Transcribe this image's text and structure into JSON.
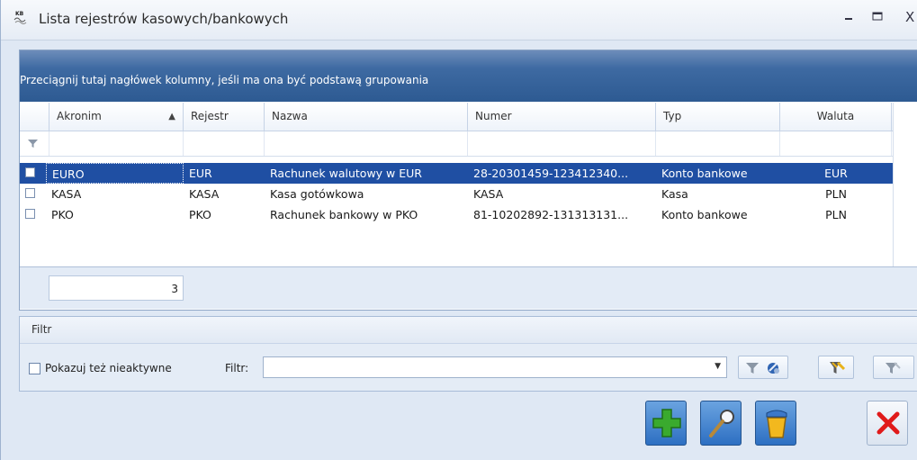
{
  "window": {
    "title": "Lista rejestrów kasowych/bankowych",
    "app_icon": "kb-register-icon",
    "controls": [
      "minimize",
      "maximize",
      "close"
    ],
    "close_glyph": "X"
  },
  "grid": {
    "group_hint": "Przeciągnij tutaj nagłówek kolumny, jeśli ma ona być podstawą grupowania",
    "columns": [
      "Akronim",
      "Rejestr",
      "Nazwa",
      "Numer",
      "Typ",
      "Waluta"
    ],
    "sort_indicator": "▲",
    "filter_row_icon": "funnel-icon",
    "rows": [
      {
        "akronim": "EURO",
        "rejestr": "EUR",
        "nazwa": "Rachunek walutowy w EUR",
        "numer": "28-20301459-123412340...",
        "typ": "Konto bankowe",
        "waluta": "EUR",
        "selected": true
      },
      {
        "akronim": "KASA",
        "rejestr": "KASA",
        "nazwa": "Kasa gotówkowa",
        "numer": "KASA",
        "typ": "Kasa",
        "waluta": "PLN",
        "selected": false
      },
      {
        "akronim": "PKO",
        "rejestr": "PKO",
        "nazwa": "Rachunek bankowy w PKO",
        "numer": "81-10202892-131313131...",
        "typ": "Konto bankowe",
        "waluta": "PLN",
        "selected": false
      }
    ],
    "count": "3"
  },
  "filter_panel": {
    "header": "Filtr",
    "show_inactive_label": "Pokazuj też nieaktywne",
    "show_inactive_checked": false,
    "filter_label": "Filtr:",
    "filter_value": "",
    "tools": [
      "funnel-icon",
      "filter-wizard-icon",
      "filter-edit-icon",
      "filter-clear-icon"
    ]
  },
  "actions": [
    "add-icon",
    "view-icon",
    "delete-icon",
    "close-icon"
  ],
  "colors": {
    "selection": "#1f4fa3",
    "group_panel": "#2d5a92",
    "window_bg": "#dfe8f4"
  }
}
